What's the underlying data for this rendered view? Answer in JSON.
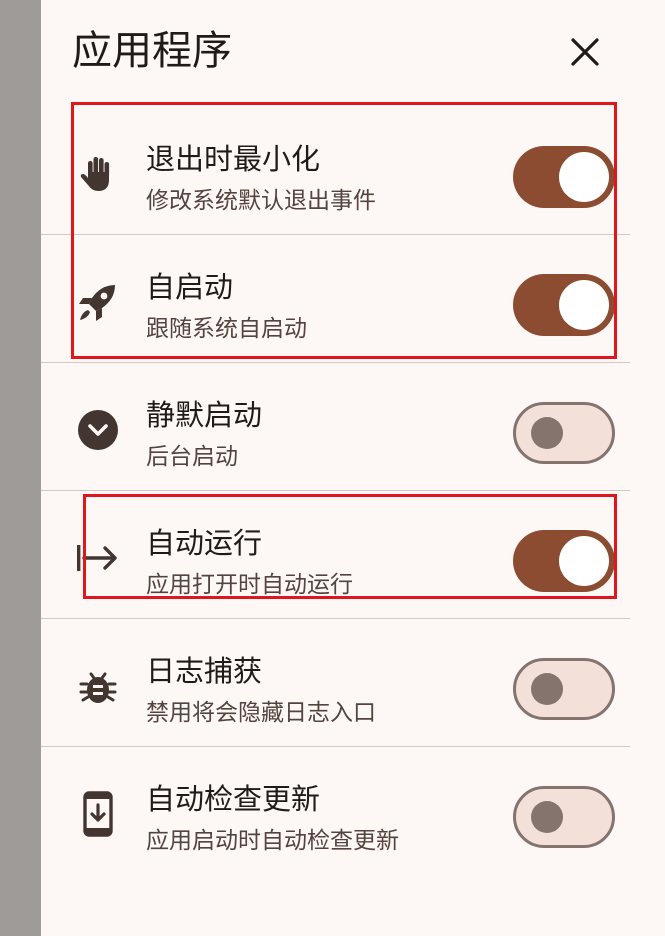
{
  "header": {
    "title": "应用程序",
    "close_icon": "close-icon"
  },
  "settings": [
    {
      "icon": "hand-icon",
      "label": "退出时最小化",
      "description": "修改系统默认退出事件",
      "enabled": true
    },
    {
      "icon": "rocket-icon",
      "label": "自启动",
      "description": "跟随系统自启动",
      "enabled": true
    },
    {
      "icon": "chevron-down-circle-icon",
      "label": "静默启动",
      "description": "后台启动",
      "enabled": false
    },
    {
      "icon": "arrow-right-bar-icon",
      "label": "自动运行",
      "description": "应用打开时自动运行",
      "enabled": true
    },
    {
      "icon": "bug-icon",
      "label": "日志捕获",
      "description": "禁用将会隐藏日志入口",
      "enabled": false
    },
    {
      "icon": "download-phone-icon",
      "label": "自动检查更新",
      "description": "应用启动时自动检查更新",
      "enabled": false
    }
  ],
  "colors": {
    "accent": "#8b4c32",
    "panel_bg": "#fdf8f6",
    "switch_off_track": "#f2e0d9",
    "switch_off_outline": "#85736e",
    "highlight": "#e0161c"
  }
}
